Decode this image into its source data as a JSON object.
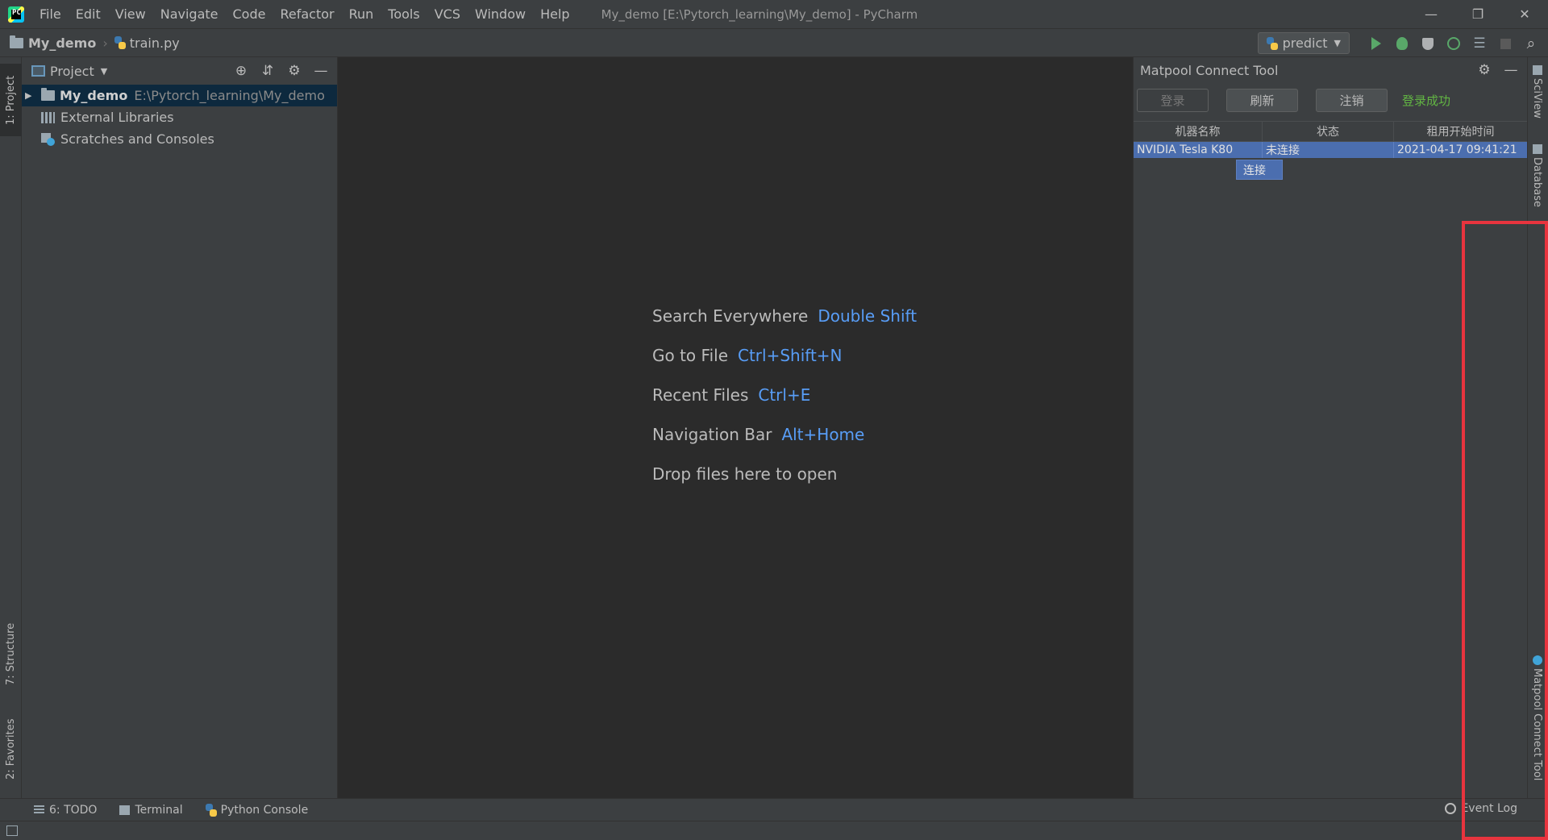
{
  "titlebar": {
    "menu": [
      "File",
      "Edit",
      "View",
      "Navigate",
      "Code",
      "Refactor",
      "Run",
      "Tools",
      "VCS",
      "Window",
      "Help"
    ],
    "title": "My_demo [E:\\Pytorch_learning\\My_demo] - PyCharm",
    "minimize": "—",
    "restore": "❐",
    "close": "✕"
  },
  "navbar": {
    "project": "My_demo",
    "file": "train.py",
    "run_config": "predict"
  },
  "left_stripe": {
    "project_tab": "1: Project",
    "structure_tab": "7: Structure",
    "favorites_tab": "2: Favorites"
  },
  "project_panel": {
    "title": "Project",
    "tree": [
      {
        "name": "My_demo",
        "path": "E:\\Pytorch_learning\\My_demo"
      },
      {
        "name": "External Libraries"
      },
      {
        "name": "Scratches and Consoles"
      }
    ]
  },
  "editor": {
    "hints": [
      {
        "label": "Search Everywhere",
        "key": "Double Shift"
      },
      {
        "label": "Go to File",
        "key": "Ctrl+Shift+N"
      },
      {
        "label": "Recent Files",
        "key": "Ctrl+E"
      },
      {
        "label": "Navigation Bar",
        "key": "Alt+Home"
      },
      {
        "label": "Drop files here to open",
        "key": ""
      }
    ]
  },
  "matpool": {
    "title": "Matpool Connect Tool",
    "login_label": "登录",
    "refresh_label": "刷新",
    "logout_label": "注销",
    "status": "登录成功",
    "columns": [
      "机器名称",
      "状态",
      "租用开始时间"
    ],
    "rows": [
      {
        "name": "NVIDIA Tesla K80",
        "state": "未连接",
        "start": "2021-04-17 09:41:21"
      }
    ],
    "context_menu": "连接"
  },
  "right_stripe": {
    "sciview": "SciView",
    "database": "Database",
    "matpool": "Matpool Connect Tool"
  },
  "bottom_bar": {
    "todo": "6: TODO",
    "terminal": "Terminal",
    "python_console": "Python Console",
    "event_log": "Event Log"
  },
  "colors": {
    "accent_key": "#589df6",
    "selection": "#4b6eaf",
    "success": "#62b543",
    "highlight": "#e8343e"
  }
}
